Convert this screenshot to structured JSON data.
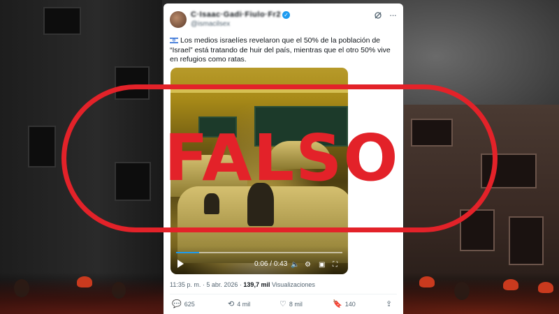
{
  "post": {
    "display_name": "C·Isaac·Gadi·Fiulo·Fr2",
    "handle": "@ismacilsex",
    "text": "Los medios israelíes revelaron que el 50% de la población de “Israel” está tratando de huir del país, mientras que el otro 50% vive en refugios como ratas.",
    "video": {
      "current_time": "0:06",
      "duration": "0:43",
      "progress": 0.14
    },
    "timestamp": "11:35 p. m. · 5 abr. 2026 ·",
    "views_count": "139,7 mil",
    "views_label": "Visualizaciones",
    "actions": {
      "replies": "625",
      "reposts": "4 mil",
      "likes": "8 mil",
      "bookmarks": "140"
    }
  },
  "overlay": {
    "stamp_text": "FALSO",
    "stamp_color": "#e32229"
  },
  "icons": [
    "verified-icon",
    "grok-icon",
    "more-icon",
    "play-icon",
    "volume-icon",
    "settings-icon",
    "pip-icon",
    "fullscreen-icon",
    "reply-icon",
    "repost-icon",
    "like-icon",
    "bookmark-icon",
    "share-icon"
  ]
}
